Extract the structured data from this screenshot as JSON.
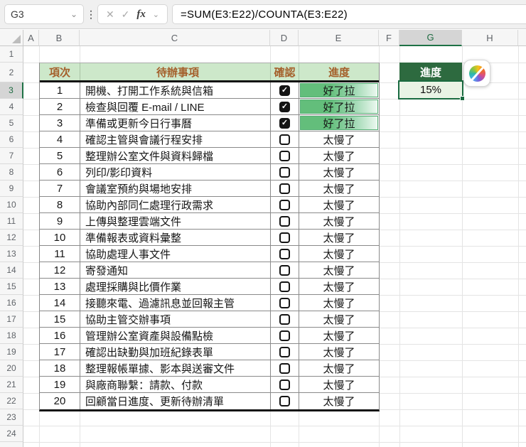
{
  "colors": {
    "accent_green": "#1E7145",
    "table_header_fill": "#CDE8CA",
    "table_header_text": "#A4602B",
    "databar_green": "#63BE7B",
    "summary_header_fill": "#2D6A3F",
    "summary_value_fill": "#E9F3E5"
  },
  "formula_bar": {
    "name_box_value": "G3",
    "formula": "=SUM(E3:E22)/COUNTA(E3:E22)",
    "fx_label": "fx"
  },
  "icons": {
    "name_box_chevron": "⌄",
    "menu_dots": "⋮",
    "cancel": "✕",
    "enter": "✓",
    "formula_chevron": "⌄",
    "check": "✓"
  },
  "grid": {
    "column_headers": [
      "A",
      "B",
      "C",
      "D",
      "E",
      "F",
      "G",
      "H"
    ],
    "row_numbers": [
      1,
      2,
      3,
      4,
      5,
      6,
      7,
      8,
      9,
      10,
      11,
      12,
      13,
      14,
      15,
      16,
      17,
      18,
      19,
      20,
      21,
      22,
      23,
      24
    ],
    "selected_column": "G",
    "selected_row": 3
  },
  "table": {
    "headers": {
      "item": "項次",
      "task": "待辦事項",
      "confirm": "確認",
      "progress": "進度"
    },
    "rows": [
      {
        "num": 1,
        "task": "開機、打開工作系統與信箱",
        "checked": true,
        "progress": "好了拉"
      },
      {
        "num": 2,
        "task": "檢查與回覆 E-mail / LINE",
        "checked": true,
        "progress": "好了拉"
      },
      {
        "num": 3,
        "task": "準備或更新今日行事曆",
        "checked": true,
        "progress": "好了拉"
      },
      {
        "num": 4,
        "task": "確認主管與會議行程安排",
        "checked": false,
        "progress": "太慢了"
      },
      {
        "num": 5,
        "task": "整理辦公室文件與資料歸檔",
        "checked": false,
        "progress": "太慢了"
      },
      {
        "num": 6,
        "task": "列印/影印資料",
        "checked": false,
        "progress": "太慢了"
      },
      {
        "num": 7,
        "task": "會議室預約與場地安排",
        "checked": false,
        "progress": "太慢了"
      },
      {
        "num": 8,
        "task": "協助內部同仁處理行政需求",
        "checked": false,
        "progress": "太慢了"
      },
      {
        "num": 9,
        "task": "上傳與整理雲端文件",
        "checked": false,
        "progress": "太慢了"
      },
      {
        "num": 10,
        "task": "準備報表或資料彙整",
        "checked": false,
        "progress": "太慢了"
      },
      {
        "num": 11,
        "task": "協助處理人事文件",
        "checked": false,
        "progress": "太慢了"
      },
      {
        "num": 12,
        "task": "寄發通知",
        "checked": false,
        "progress": "太慢了"
      },
      {
        "num": 13,
        "task": "處理採購與比價作業",
        "checked": false,
        "progress": "太慢了"
      },
      {
        "num": 14,
        "task": "接聽來電、過濾訊息並回報主管",
        "checked": false,
        "progress": "太慢了"
      },
      {
        "num": 15,
        "task": "協助主管交辦事項",
        "checked": false,
        "progress": "太慢了"
      },
      {
        "num": 16,
        "task": "管理辦公室資產與設備點檢",
        "checked": false,
        "progress": "太慢了"
      },
      {
        "num": 17,
        "task": "確認出缺勤與加班紀錄表單",
        "checked": false,
        "progress": "太慢了"
      },
      {
        "num": 18,
        "task": "整理報帳單據、影本與送審文件",
        "checked": false,
        "progress": "太慢了"
      },
      {
        "num": 19,
        "task": "與廠商聯繫：請款、付款",
        "checked": false,
        "progress": "太慢了"
      },
      {
        "num": 20,
        "task": "回顧當日進度、更新待辦清單",
        "checked": false,
        "progress": "太慢了"
      }
    ]
  },
  "summary": {
    "header": "進度",
    "value": "15%"
  }
}
